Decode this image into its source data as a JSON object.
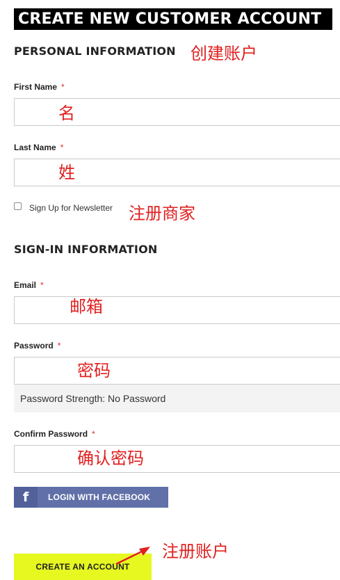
{
  "page": {
    "title": "CREATE NEW CUSTOMER ACCOUNT"
  },
  "personal": {
    "title": "PERSONAL INFORMATION",
    "annotation": "创建账户",
    "first_name": {
      "label": "First Name",
      "required_mark": "*",
      "value": "",
      "annotation": "名"
    },
    "last_name": {
      "label": "Last Name",
      "required_mark": "*",
      "value": "",
      "annotation": "姓"
    },
    "newsletter": {
      "label": "Sign Up for Newsletter",
      "checked": false,
      "annotation": "注册商家"
    }
  },
  "signin": {
    "title": "SIGN-IN INFORMATION",
    "email": {
      "label": "Email",
      "required_mark": "*",
      "value": "",
      "annotation": "邮箱"
    },
    "password": {
      "label": "Password",
      "required_mark": "*",
      "value": "",
      "annotation": "密码",
      "strength_text": "Password Strength: No Password"
    },
    "confirm_password": {
      "label": "Confirm Password",
      "required_mark": "*",
      "value": "",
      "annotation": "确认密码"
    }
  },
  "facebook": {
    "icon": "facebook-icon",
    "icon_glyph": "f",
    "label": "LOGIN WITH FACEBOOK",
    "color": "#6170a8"
  },
  "create": {
    "label": "CREATE AN ACCOUNT",
    "annotation": "注册账户",
    "color": "#e6f820"
  },
  "colors": {
    "annotation": "#e02020",
    "required": "#e02b27"
  }
}
